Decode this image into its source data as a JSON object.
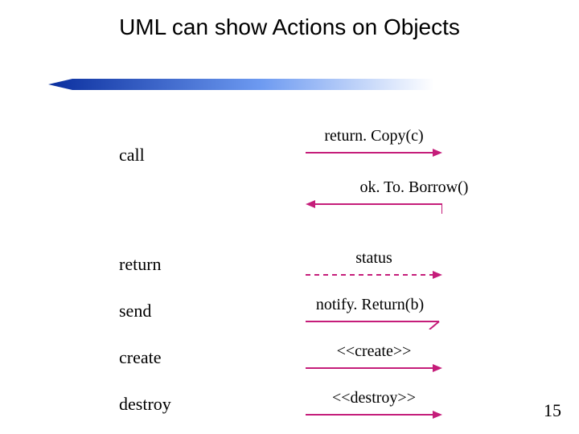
{
  "title": "UML can show Actions on Objects",
  "labels": {
    "call": "call",
    "return": "return",
    "send": "send",
    "create": "create",
    "destroy": "destroy"
  },
  "arrows": {
    "returnCopy": "return. Copy(c)",
    "okToBorrow": "ok. To. Borrow()",
    "status": "status",
    "notifyReturn": "notify. Return(b)",
    "createStereo": "<<create>>",
    "destroyStereo": "<<destroy>>"
  },
  "colors": {
    "accent": "#c51d7a",
    "dividerBlue": "#3b6fd6"
  },
  "pageNumber": "15"
}
